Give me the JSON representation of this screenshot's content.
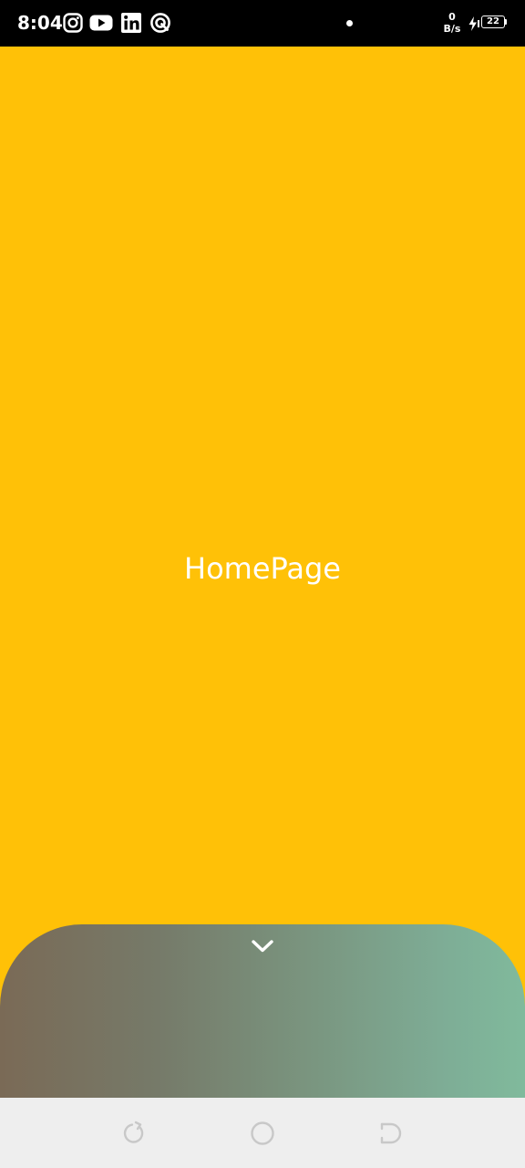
{
  "status_bar": {
    "time": "8:04",
    "notification_icons": [
      "instagram-icon",
      "youtube-icon",
      "linkedin-icon",
      "quora-icon"
    ],
    "net_speed_value": "0",
    "net_speed_unit": "B/s",
    "battery_level": "22",
    "charging": true
  },
  "main": {
    "title": "HomePage",
    "background_color": "#FFC107",
    "title_color": "#FFFFFF"
  },
  "bottom_sheet": {
    "toggle_icon": "chevron-down-icon",
    "gradient_colors": [
      "#7A6A56",
      "#767A69",
      "#7A9680",
      "#7EAD96",
      "#80BA9C"
    ]
  },
  "nav_bar": {
    "buttons": [
      "recents-icon",
      "home-icon",
      "back-icon"
    ],
    "background_color": "#EEEEEE"
  }
}
